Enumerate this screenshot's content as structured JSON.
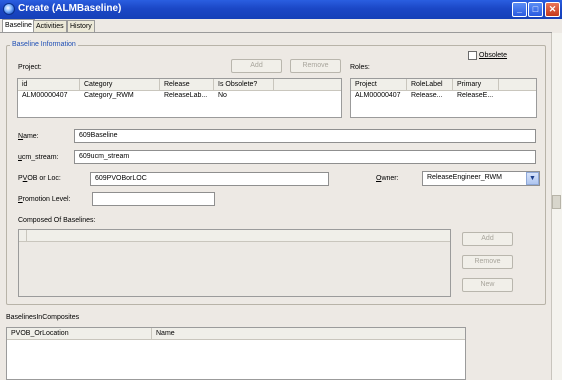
{
  "window": {
    "title": "Create (ALMBaseline)"
  },
  "tabs": [
    {
      "label": "Baseline"
    },
    {
      "label": "Activities"
    },
    {
      "label": "History"
    }
  ],
  "baseline_info": {
    "title": "Baseline Information",
    "obsolete_label": "Obsolete",
    "obsolete_checked": false,
    "project_label": "Project:",
    "project_add": "Add",
    "project_remove": "Remove",
    "project_table": {
      "columns": [
        "id",
        "Category",
        "Release",
        "Is Obsolete?"
      ],
      "rows": [
        [
          "ALM00000407",
          "Category_RWM",
          "ReleaseLab...",
          "No"
        ]
      ]
    },
    "roles_label": "Roles:",
    "roles_table": {
      "columns": [
        "Project",
        "RoleLabel",
        "Primary"
      ],
      "rows": [
        [
          "ALM00000407",
          "Release...",
          "ReleaseE..."
        ]
      ]
    },
    "name": {
      "label_u": "N",
      "label_rest": "ame:",
      "value": "609Baseline"
    },
    "ucm_stream": {
      "label_u": "u",
      "label_rest": "cm_stream:",
      "value": "609ucm_stream"
    },
    "pvob": {
      "label_pre": "P",
      "label_u": "V",
      "label_rest": "OB or Loc:",
      "value": "609PVOBorLOC"
    },
    "owner": {
      "label_u": "O",
      "label_rest": "wner:",
      "value": "ReleaseEngineer_RWM"
    },
    "promotion": {
      "label_u": "P",
      "label_rest": "romotion Level:",
      "value": ""
    },
    "composed_label": "Composed Of Baselines:",
    "composed_add": "Add",
    "composed_remove": "Remove",
    "composed_new": "New"
  },
  "composites": {
    "label": "BaselinesInComposites",
    "columns": [
      "PVOB_OrLocation",
      "Name"
    ]
  }
}
